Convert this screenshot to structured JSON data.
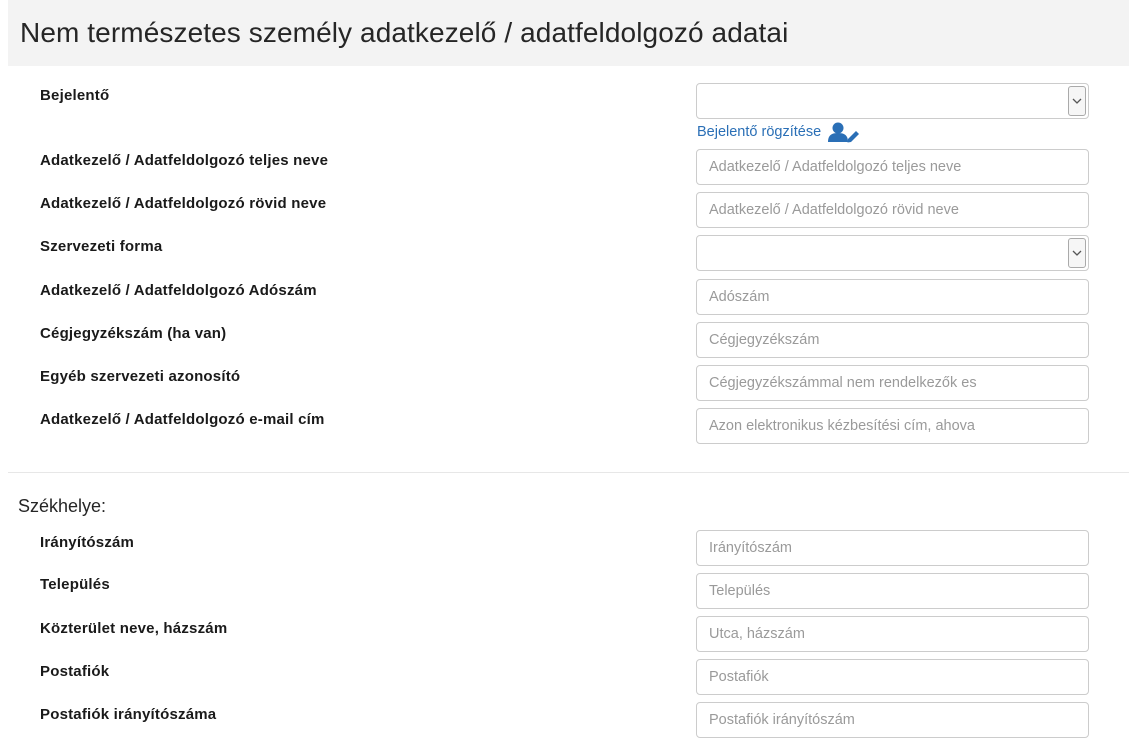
{
  "header": {
    "title": "Nem természetes személy adatkezelő / adatfeldolgozó adatai"
  },
  "form": {
    "bejelento": {
      "label": "Bejelentő",
      "value": "",
      "link": "Bejelentő rögzítése",
      "link_icon": "user-edit-icon"
    },
    "teljes_nev": {
      "label": "Adatkezelő / Adatfeldolgozó teljes neve",
      "placeholder": "Adatkezelő / Adatfeldolgozó teljes neve",
      "value": ""
    },
    "rovid_nev": {
      "label": "Adatkezelő / Adatfeldolgozó rövid neve",
      "placeholder": "Adatkezelő / Adatfeldolgozó rövid neve",
      "value": ""
    },
    "szervezeti_forma": {
      "label": "Szervezeti forma",
      "value": ""
    },
    "adoszam": {
      "label": "Adatkezelő / Adatfeldolgozó Adószám",
      "placeholder": "Adószám",
      "value": ""
    },
    "cegjegyzekszam": {
      "label": "Cégjegyzékszám (ha van)",
      "placeholder": "Cégjegyzékszám",
      "value": ""
    },
    "egyeb_azonosito": {
      "label": "Egyéb szervezeti azonosító",
      "placeholder": "Cégjegyzékszámmal nem rendelkezők es",
      "value": ""
    },
    "email": {
      "label": "Adatkezelő / Adatfeldolgozó e-mail cím",
      "placeholder": "Azon elektronikus kézbesítési cím, ahova",
      "value": ""
    }
  },
  "szekhely": {
    "title": "Székhelye:",
    "iranyitoszam": {
      "label": "Irányítószám",
      "placeholder": "Irányítószám",
      "value": ""
    },
    "telepules": {
      "label": "Település",
      "placeholder": "Település",
      "value": ""
    },
    "kozterulet": {
      "label": "Közterület neve, házszám",
      "placeholder": "Utca, házszám",
      "value": ""
    },
    "postafiok": {
      "label": "Postafiók",
      "placeholder": "Postafiók",
      "value": ""
    },
    "postafiok_iranyitoszam": {
      "label": "Postafiók irányítószáma",
      "placeholder": "Postafiók irányítószám",
      "value": ""
    }
  },
  "colors": {
    "header_bg": "#f3f3f3",
    "link": "#2a6fb6",
    "border": "#cccccc",
    "placeholder": "#9a9a9a"
  }
}
